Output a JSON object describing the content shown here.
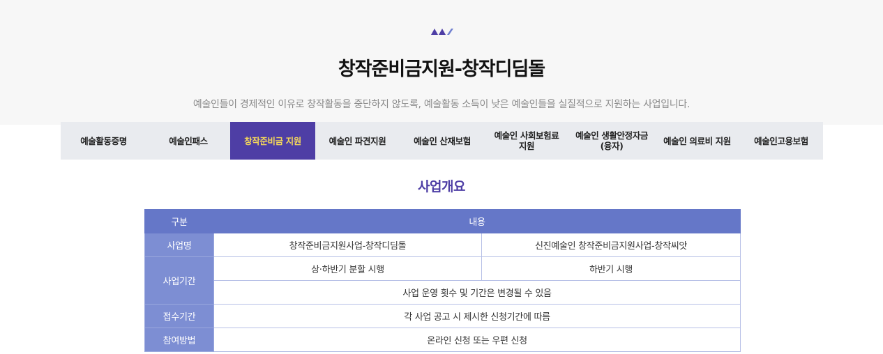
{
  "header": {
    "title": "창작준비금지원-창작디딤돌",
    "description": "예술인들이 경제적인 이유로 창작활동을 중단하지 않도록, 예술활동 소득이 낮은 예술인들을 실질적으로 지원하는 사업입니다.",
    "logo_icon": "triangles-logo-icon",
    "accent_color": "#4e3ea5"
  },
  "tabs": [
    {
      "label": "예술활동증명",
      "active": false
    },
    {
      "label": "예술인패스",
      "active": false
    },
    {
      "label": "창작준비금 지원",
      "active": true
    },
    {
      "label": "예술인 파견지원",
      "active": false
    },
    {
      "label": "예술인 산재보험",
      "active": false
    },
    {
      "label": "예술인 사회보험료\n지원",
      "active": false
    },
    {
      "label": "예술인 생활안정자금\n(융자)",
      "active": false
    },
    {
      "label": "예술인 의료비 지원",
      "active": false
    },
    {
      "label": "예술인고용보험",
      "active": false
    }
  ],
  "section": {
    "title": "사업개요"
  },
  "table": {
    "headers": [
      "구분",
      "내용"
    ],
    "rows": {
      "name": {
        "label": "사업명",
        "values": [
          "창작준비금지원사업-창작디딤돌",
          "신진예술인 창작준비금지원사업-창작씨앗"
        ]
      },
      "period": {
        "label": "사업기간",
        "values": [
          "상·하반기 분할 시행",
          "하반기 시행"
        ],
        "note": "사업 운영 횟수 및 기간은 변경될 수 있음"
      },
      "application": {
        "label": "접수기간",
        "value": "각 사업 공고 시 제시한 신청기간에 따름"
      },
      "method": {
        "label": "참여방법",
        "value": "온라인 신청 또는 우편 신청"
      }
    }
  }
}
